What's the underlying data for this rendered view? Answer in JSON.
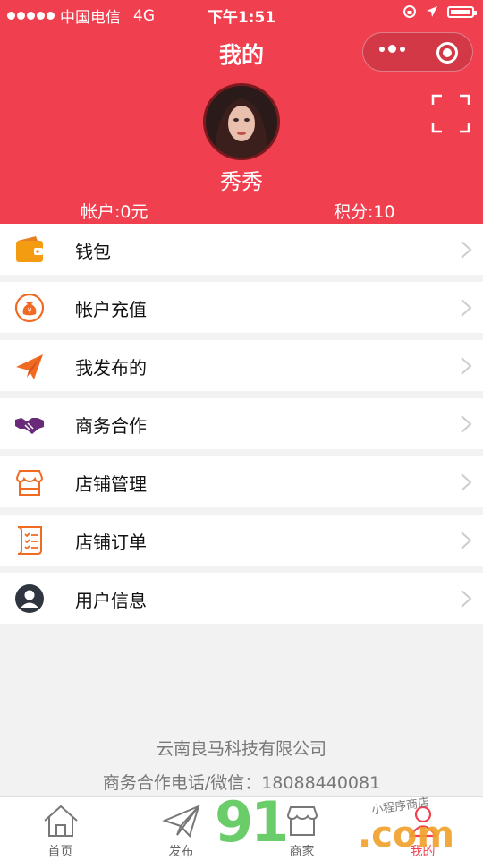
{
  "status_bar": {
    "carrier": "中国电信",
    "network": "4G",
    "time": "下午1:51"
  },
  "nav": {
    "title": "我的"
  },
  "profile": {
    "name": "秀秀",
    "account_balance": "帐户:0元",
    "points": "积分:10"
  },
  "menu": [
    {
      "label": "钱包",
      "icon": "wallet-icon",
      "color": "#f39c12"
    },
    {
      "label": "帐户充值",
      "icon": "money-bag-icon",
      "color": "#f06a22"
    },
    {
      "label": "我发布的",
      "icon": "paper-plane-icon",
      "color": "#f06a22"
    },
    {
      "label": "商务合作",
      "icon": "handshake-icon",
      "color": "#6a2a7a"
    },
    {
      "label": "店铺管理",
      "icon": "store-icon",
      "color": "#f06a22"
    },
    {
      "label": "店铺订单",
      "icon": "order-list-icon",
      "color": "#f06a22"
    },
    {
      "label": "用户信息",
      "icon": "user-circle-icon",
      "color": "#2f3640"
    }
  ],
  "footer": {
    "company": "云南良马科技有限公司",
    "contact": "商务合作电话/微信：18088440081"
  },
  "tabbar": [
    {
      "label": "首页",
      "icon": "home-icon"
    },
    {
      "label": "发布",
      "icon": "send-icon"
    },
    {
      "label": "商家",
      "icon": "shop-icon"
    },
    {
      "label": "我的",
      "icon": "profile-icon"
    }
  ],
  "watermark": {
    "main": "91",
    "domain": ".com",
    "tagline": "小程序商店"
  },
  "colors": {
    "brand_red": "#f0404f",
    "background": "#f2f2f2"
  }
}
